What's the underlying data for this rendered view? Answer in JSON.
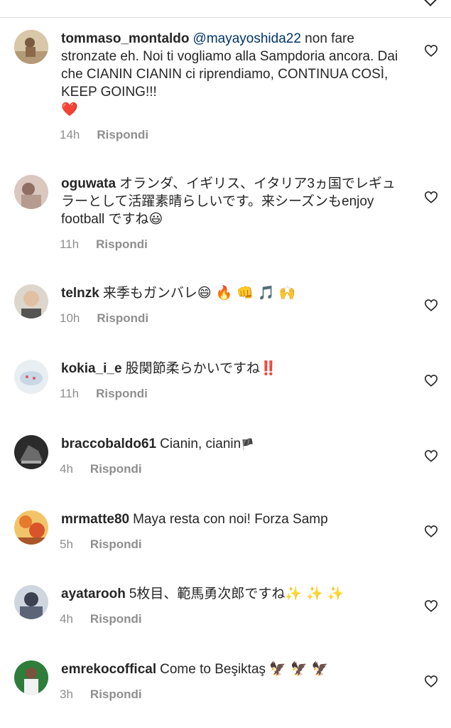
{
  "comments": [
    {
      "username": "tommaso_montaldo",
      "mention": "@mayayoshida22",
      "text": " non fare stronzate eh. Noi ti vogliamo alla Sampdoria ancora. Dai che CIANIN CIANIN ci riprendiamo, CONTINUA COSÌ, KEEP GOING!!!",
      "emoji": "❤️",
      "time": "14h",
      "reply": "Rispondi"
    },
    {
      "username": "oguwata",
      "text": "オランダ、イギリス、イタリア3ヵ国でレギュラーとして活躍素晴らしいです。来シーズンもenjoy football ですね",
      "emoji": "😃",
      "time": "11h",
      "reply": "Rispondi"
    },
    {
      "username": "telnzk",
      "text": "来季もガンバレ",
      "emoji": "😄 🔥 👊 🎵 🙌",
      "time": "10h",
      "reply": "Rispondi"
    },
    {
      "username": "kokia_i_e",
      "text": "股関節柔らかいですね",
      "emoji": "‼️",
      "time": "11h",
      "reply": "Rispondi"
    },
    {
      "username": "braccobaldo61",
      "text": "Cianin, cianin",
      "emoji": "🏴",
      "time": "4h",
      "reply": "Rispondi"
    },
    {
      "username": "mrmatte80",
      "text": "Maya resta con noi! Forza Samp",
      "emoji": "",
      "time": "5h",
      "reply": "Rispondi"
    },
    {
      "username": "ayatarooh",
      "text": "5枚目、範馬勇次郎ですね",
      "emoji": "✨ ✨ ✨",
      "time": "4h",
      "reply": "Rispondi"
    },
    {
      "username": "emrekocoffical",
      "text": "Come to Beşiktaş",
      "emoji": "🦅 🦅 🦅",
      "time": "3h",
      "reply": "Rispondi"
    }
  ],
  "icons": {
    "like": "heart-icon",
    "collapse": "chevron-down-icon"
  },
  "colors": {
    "username": "#262626",
    "mention": "#003569",
    "meta": "#8e8e8e",
    "heart_stroke": "#262626"
  }
}
